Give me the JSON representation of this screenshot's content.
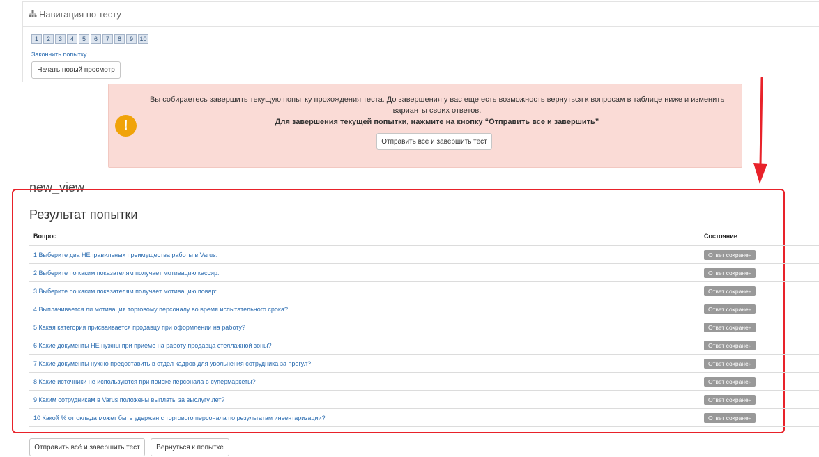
{
  "nav": {
    "title": "Навигация по тесту",
    "icon": "sitemap-icon",
    "question_numbers": [
      "1",
      "2",
      "3",
      "4",
      "5",
      "6",
      "7",
      "8",
      "9",
      "10"
    ],
    "finish_link": "Закончить попытку...",
    "new_preview_button": "Начать новый просмотр"
  },
  "alert": {
    "icon": "exclamation-icon",
    "text": "Вы собираетесь завершить текущую попытку прохождения теста. До завершения у вас еще есть возможность вернуться к вопросам в таблице ниже и изменить варианты своих ответов.",
    "bold_text": "Для завершения текущей попытки, нажмите на кнопку “Отправить все и завершить”",
    "submit_button": "Отправить всё и завершить тест",
    "background": "#fadbd6"
  },
  "view_title": "new_view",
  "result": {
    "title": "Результат попытки",
    "columns": {
      "question": "Вопрос",
      "status": "Состояние"
    },
    "rows": [
      {
        "question": "1 Выберите два НЕправильных преимущества работы в Varus:",
        "status": "Ответ сохранен"
      },
      {
        "question": "2 Выберите по каким показателям получает мотивацию кассир:",
        "status": "Ответ сохранен"
      },
      {
        "question": "3 Выберите по каким показателям получает мотивацию повар:",
        "status": "Ответ сохранен"
      },
      {
        "question": "4 Выплачивается ли мотивация торговому персоналу во время испытательного срока?",
        "status": "Ответ сохранен"
      },
      {
        "question": "5 Какая категория присваивается продавцу при оформлении на работу?",
        "status": "Ответ сохранен"
      },
      {
        "question": "6 Какие документы НЕ нужны при приеме на работу продавца стеллажной зоны?",
        "status": "Ответ сохранен"
      },
      {
        "question": "7 Какие документы нужно предоставить в отдел кадров для увольнения сотрудника за прогул?",
        "status": "Ответ сохранен"
      },
      {
        "question": "8 Какие источники не используются при поиске персонала в супермаркеты?",
        "status": "Ответ сохранен"
      },
      {
        "question": "9 Каким сотрудникам в Varus положены выплаты за выслугу лет?",
        "status": "Ответ сохранен"
      },
      {
        "question": "10 Какой % от оклада может быть удержан с торгового персонала по результатам инвентаризации?",
        "status": "Ответ сохранен"
      }
    ]
  },
  "footer": {
    "submit_button": "Отправить всё и завершить тест",
    "return_button": "Вернуться к попытке"
  },
  "colors": {
    "highlight_frame": "#e8222a",
    "link": "#2b6cb0",
    "badge": "#999999"
  }
}
